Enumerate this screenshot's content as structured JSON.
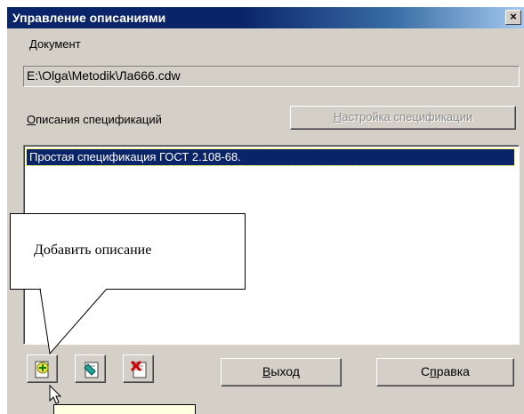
{
  "window": {
    "title": "Управление описаниями",
    "close_symbol": "×"
  },
  "document": {
    "label": "Документ",
    "path": "E:\\Olga\\Metodik\\Ла666.cdw"
  },
  "specs": {
    "label_mnemonic": "О",
    "label_rest": "писания спецификаций",
    "setup_button_mnemonic": "Н",
    "setup_button_rest": "астройка спецификации",
    "items": [
      "Простая спецификация ГОСТ 2.108-68."
    ]
  },
  "tooltip": {
    "text": "Добавить описание"
  },
  "toolbar": {
    "icons": [
      "add-description-icon",
      "edit-description-icon",
      "delete-description-icon"
    ]
  },
  "buttons": {
    "exit_mnemonic": "В",
    "exit_rest": "ыход",
    "help_prefix": "С",
    "help_mnemonic": "п",
    "help_rest": "равка"
  },
  "colors": {
    "title_bar": "#0a246a",
    "selection": "#0a246a",
    "face": "#d4d0c8"
  }
}
